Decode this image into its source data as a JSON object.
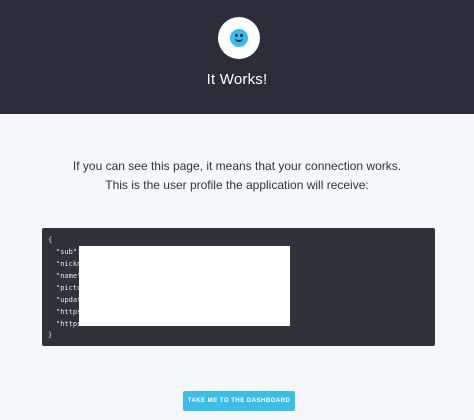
{
  "header": {
    "title": "It Works!",
    "logo_icon": "smiley-face-icon",
    "background_color": "#2b2e3a",
    "accent_color": "#3bbbe8"
  },
  "intro": {
    "line1": "If you can see this page, it means that your connection works.",
    "line2": "This is the user profile the application will receive:"
  },
  "profile_json": {
    "open_brace": "{",
    "lines": [
      "\"sub\":",
      "\"nickn",
      "\"name\":",
      "\"pictur",
      "\"update",
      "\"https:",
      "\"https:"
    ],
    "close_brace": "}"
  },
  "dashboard_button": {
    "label": "TAKE ME TO THE DASHBOARD",
    "color": "#3cbde8"
  }
}
